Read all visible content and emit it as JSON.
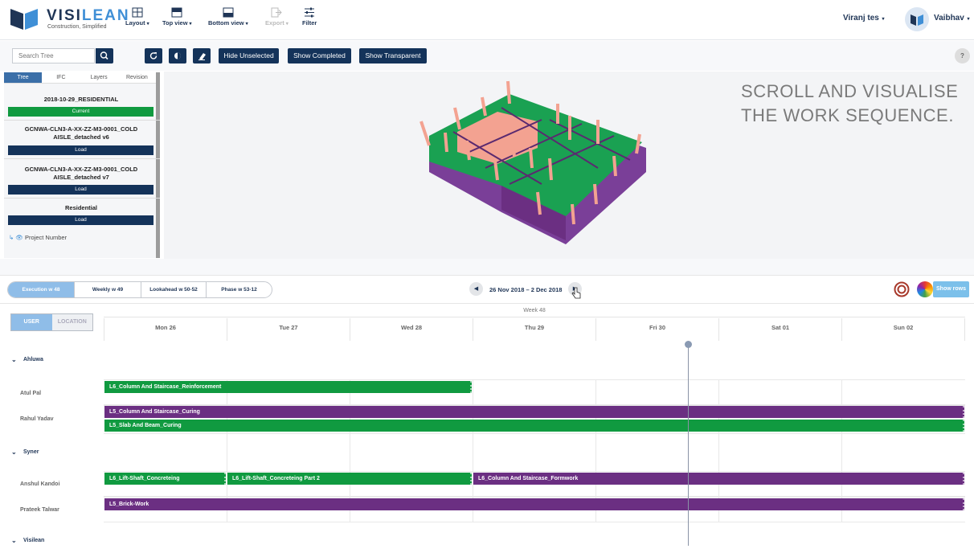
{
  "header": {
    "brand_a": "VISI",
    "brand_b": "LEAN",
    "tagline": "Construction, Simplified",
    "tools": [
      {
        "label": "Layout",
        "icon": "layout-icon"
      },
      {
        "label": "Top view",
        "icon": "top-view-icon"
      },
      {
        "label": "Bottom view",
        "icon": "bottom-view-icon"
      },
      {
        "label": "Export",
        "icon": "export-icon",
        "disabled": true
      },
      {
        "label": "Filter",
        "icon": "filter-icon"
      }
    ],
    "project_user": "Viranj tes",
    "user_name": "Vaibhav"
  },
  "toolbar": {
    "search_placeholder": "Search Tree",
    "hide_unselected": "Hide Unselected",
    "show_completed": "Show Completed",
    "show_transparent": "Show Transparent",
    "help": "?"
  },
  "tree": {
    "tabs": [
      "Tree",
      "IFC",
      "Layers",
      "Revision"
    ],
    "models": [
      {
        "name": "2018-10-29_RESIDENTIAL",
        "action": "Current",
        "status_color": "#109a40"
      },
      {
        "name": "GCNWA-CLN3-A-XX-ZZ-M3-0001_COLD AISLE_detached v6",
        "action": "Load",
        "status_color": "#14335a"
      },
      {
        "name": "GCNWA-CLN3-A-XX-ZZ-M3-0001_COLD AISLE_detached v7",
        "action": "Load",
        "status_color": "#14335a"
      },
      {
        "name": "Residential",
        "action": "Load",
        "status_color": "#14335a"
      }
    ],
    "project_number": "Project Number"
  },
  "viewer": {
    "overlay_line1": "SCROLL AND VISUALISE",
    "overlay_line2": "THE WORK SEQUENCE."
  },
  "planner": {
    "modes": [
      {
        "label": "Execution",
        "week": "w 48",
        "active": true
      },
      {
        "label": "Weekly",
        "week": "w 49"
      },
      {
        "label": "Lookahead",
        "week": "w 50-52"
      },
      {
        "label": "Phase",
        "week": "w 53-12"
      }
    ],
    "date_range": "26 Nov 2018 – 2 Dec 2018",
    "show_rows": "Show rows",
    "view_user": "USER",
    "view_location": "LOCATION",
    "week_label": "Week 48",
    "days": [
      "Mon 26",
      "Tue 27",
      "Wed 28",
      "Thu 29",
      "Fri 30",
      "Sat 01",
      "Sun 02"
    ]
  },
  "schedule": {
    "groups": [
      {
        "name": "Ahluwa"
      },
      {
        "name": "Syner"
      },
      {
        "name": "Visilean"
      }
    ],
    "rows": [
      {
        "person": "Atul Pal"
      },
      {
        "person": "Rahul Yadav"
      },
      {
        "person": "Anshul Kandoi"
      },
      {
        "person": "Prateek Talwar"
      }
    ],
    "tasks": [
      {
        "label": "L6_Column And Staircase_Reinforcement",
        "color": "green"
      },
      {
        "label": "L5_Column And Staircase_Curing",
        "color": "purple"
      },
      {
        "label": "L5_Slab And Beam_Curing",
        "color": "green"
      },
      {
        "label": "L6_Lift-Shaft_Concreteing",
        "color": "green"
      },
      {
        "label": "L6_Lift-Shaft_Concreteing Part 2",
        "color": "green"
      },
      {
        "label": "L6_Column And Staircase_Formwork",
        "color": "purple"
      },
      {
        "label": "L5_Brick-Work",
        "color": "purple"
      }
    ]
  },
  "colors": {
    "navy": "#14335a",
    "green": "#109a40",
    "purple": "#6b2f82",
    "accent_blue": "#8fbde8"
  }
}
